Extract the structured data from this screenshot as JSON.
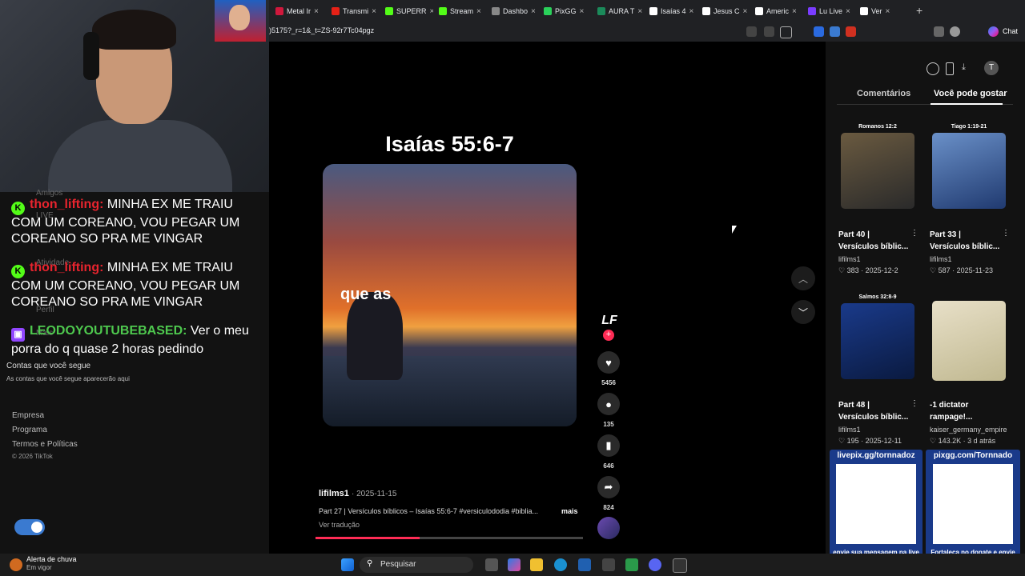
{
  "tabs": [
    {
      "label": "Metal Ir",
      "color": "#d0183c"
    },
    {
      "label": "Transmi",
      "color": "#e62117"
    },
    {
      "label": "SUPERR",
      "color": "#53fc18"
    },
    {
      "label": "Stream",
      "color": "#53fc18"
    },
    {
      "label": "Dashbo",
      "color": "#888888"
    },
    {
      "label": "PixGG",
      "color": "#2ad15a"
    },
    {
      "label": "AURA T",
      "color": "#1b8a5a"
    },
    {
      "label": "Isaías 4",
      "color": "#ffffff"
    },
    {
      "label": "Jesus C",
      "color": "#ffffff"
    },
    {
      "label": "Americ",
      "color": "#ffffff"
    },
    {
      "label": "Lu Live",
      "color": "#7a3cff"
    },
    {
      "label": "Ver",
      "color": "#ffffff"
    }
  ],
  "address": {
    "url": ")5175?_r=1&_t=ZS-92r7Tc04pgz",
    "chat_label": "Chat"
  },
  "chat": [
    {
      "user": "thon_lifting:",
      "text": "MINHA EX ME TRAIU COM UM COREANO, VOU PEGAR UM COREANO SO PRA ME VINGAR",
      "badge": "K",
      "user_color": "#e8242e",
      "badge_color": "#53fc18"
    },
    {
      "user": "thon_lifting:",
      "text": "MINHA EX ME TRAIU COM UM COREANO, VOU PEGAR UM COREANO SO PRA ME VINGAR",
      "badge": "K",
      "user_color": "#e8242e",
      "badge_color": "#53fc18"
    },
    {
      "user": "LEODOYOUTUBEBASED:",
      "text": "Ver o meu porra do q quase 2 horas pedindo",
      "badge": "▣",
      "user_color": "#4ec94e",
      "badge_color": "#9146ff"
    }
  ],
  "sidebar": {
    "ghost_friends": "Amigos",
    "ghost_live": "LIVE",
    "ghost_activity": "Atividade",
    "ghost_profile": "Perfil",
    "ghost_more": "Mais",
    "following_title": "Contas que você segue",
    "following_note": "As contas que você segue aparecerão aqui",
    "footer": [
      "Empresa",
      "Programa",
      "Termos e Políticas"
    ],
    "copyright": "© 2026 TikTok"
  },
  "video": {
    "title": "Isaías 55:6-7",
    "caption": "que as",
    "author": "lifilms1",
    "date": "· 2025-11-15",
    "description": "Part 27 | Versículos bíblicos – Isaías 55:6-7 #versiculododia #biblia...",
    "more": "mais",
    "translate": "Ver tradução",
    "progress": 0.39,
    "avatar_text": "LF",
    "likes": "5456",
    "comments": "135",
    "saves": "646",
    "shares": "824"
  },
  "right_panel": {
    "tab_comments": "Comentários",
    "tab_suggested": "Você pode gostar",
    "avatar_letter": "T",
    "cards": [
      {
        "thumb_title": "Romanos 12:2",
        "title1": "Part 40 |",
        "title2": "Versículos bíblic...",
        "author": "lifilms1",
        "likes": "♡ 383 · 2025-12-2",
        "color1": "#6a5a40",
        "color2": "#2a2a2a"
      },
      {
        "thumb_title": "Tiago 1:19-21",
        "title1": "Part 33 |",
        "title2": "Versículos bíblic...",
        "author": "lifilms1",
        "likes": "♡ 587 · 2025-11-23",
        "color1": "#6a90c8",
        "color2": "#203a70"
      },
      {
        "thumb_title": "Salmos 32:8-9",
        "title1": "Part 48 |",
        "title2": "Versículos bíblic...",
        "author": "lifilms1",
        "likes": "♡ 195 · 2025-12-11",
        "color1": "#1a3a8a",
        "color2": "#0a1a40"
      },
      {
        "thumb_title": "",
        "title1": "-1 dictator",
        "title2": "rampage!...",
        "author": "kaiser_germany_empire",
        "likes": "♡ 143.2K · 3 d atrás",
        "color1": "#e8e0c8",
        "color2": "#c0b890"
      }
    ]
  },
  "qr": [
    {
      "top": "livepix.gg/tornnadoz",
      "bottom": "envie sua mensagem na live via pix!"
    },
    {
      "top": "pixgg.com/Tornnado",
      "bottom": "Fortaleça no donate e envie sua mensagem!"
    }
  ],
  "taskbar": {
    "weather_title": "Alerta de chuva",
    "weather_sub": "Em vigor",
    "search": "Pesquisar"
  }
}
